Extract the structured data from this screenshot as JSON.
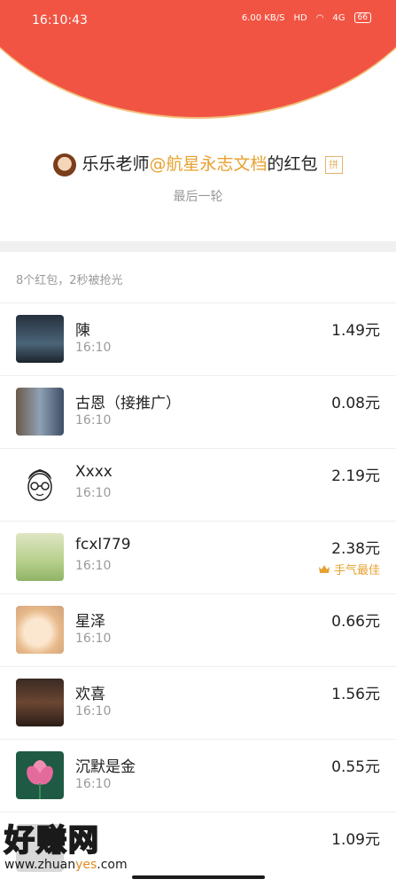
{
  "status_bar": {
    "time": "16:10:43",
    "speed": "6.00 KB/S",
    "hd": "HD",
    "network": "4G",
    "battery": "66"
  },
  "envelope": {
    "sender": "乐乐老师",
    "mention": "@航星永志文档",
    "suffix": "的红包",
    "pin_label": "拼",
    "subtitle": "最后一轮"
  },
  "summary": "8个红包，2秒被抢光",
  "recipients": [
    {
      "name": "陳",
      "time": "16:10",
      "amount": "1.49元",
      "badge": ""
    },
    {
      "name": "古恩（接推广）",
      "time": "16:10",
      "amount": "0.08元",
      "badge": ""
    },
    {
      "name": "Xxxx",
      "time": "16:10",
      "amount": "2.19元",
      "badge": ""
    },
    {
      "name": "fcxl779",
      "time": "16:10",
      "amount": "2.38元",
      "badge": "手气最佳"
    },
    {
      "name": "星泽",
      "time": "16:10",
      "amount": "0.66元",
      "badge": ""
    },
    {
      "name": "欢喜",
      "time": "16:10",
      "amount": "1.56元",
      "badge": ""
    },
    {
      "name": "沉默是金",
      "time": "16:10",
      "amount": "0.55元",
      "badge": ""
    },
    {
      "name": "",
      "time": "",
      "amount": "1.09元",
      "badge": ""
    }
  ],
  "watermark": {
    "title": "好赚网",
    "url_pre": "www.zhuan",
    "url_hl": "yes",
    "url_post": ".com"
  },
  "colors": {
    "header_red": "#f25443",
    "accent_gold": "#e7a12f"
  }
}
